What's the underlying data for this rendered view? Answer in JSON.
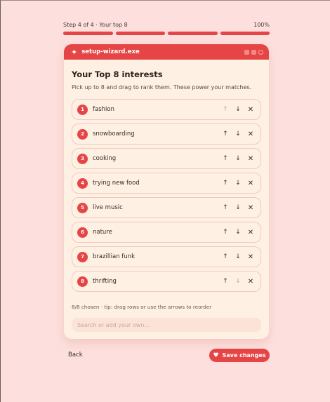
{
  "progress": {
    "step_label": "Step 4 of 4 · Your top 8",
    "percent_label": "100%",
    "percent": 100,
    "segments": 4,
    "filled": 4
  },
  "window": {
    "title": "setup-wizard.exe",
    "icon": "sparkle-icon"
  },
  "page": {
    "title": "Your Top 8 interests",
    "subtitle": "Pick up to 8 and drag to rank them. These power your matches."
  },
  "interests": [
    {
      "rank": "1",
      "label": "fashion"
    },
    {
      "rank": "2",
      "label": "snowboarding"
    },
    {
      "rank": "3",
      "label": "cooking"
    },
    {
      "rank": "4",
      "label": "trying new food"
    },
    {
      "rank": "5",
      "label": "live music"
    },
    {
      "rank": "6",
      "label": "nature"
    },
    {
      "rank": "7",
      "label": "brazillian funk"
    },
    {
      "rank": "8",
      "label": "thrifting"
    }
  ],
  "hint": "8/8 chosen · tip: drag rows or use the arrows to reorder",
  "search": {
    "placeholder": "Search or add your own...",
    "value": ""
  },
  "footer": {
    "back_label": "Back",
    "save_label": "Save changes",
    "save_icon": "heart-icon"
  },
  "colors": {
    "accent": "#e54545",
    "background": "#fde0dd",
    "card": "#fff0e4"
  }
}
